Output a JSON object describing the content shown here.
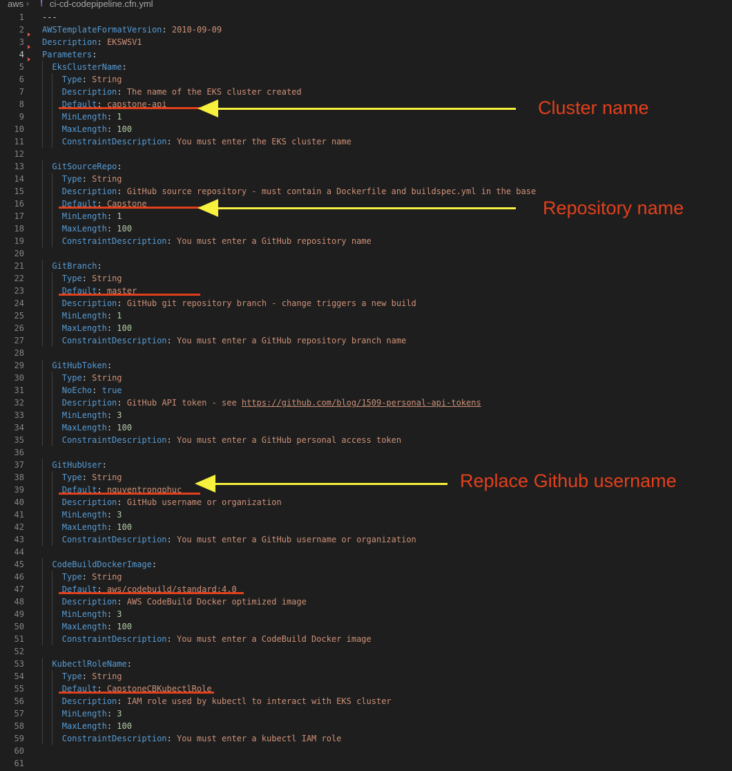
{
  "breadcrumb": {
    "folder": "aws",
    "separator": "›",
    "file_icon": "!",
    "file": "ci-cd-codepipeline.cfn.yml"
  },
  "annotations": {
    "cluster": "Cluster name",
    "repository": "Repository name",
    "github_user": "Replace Github username"
  },
  "colors": {
    "key": "#569cd6",
    "string": "#ce9178",
    "number": "#b5cea8",
    "underline": "#e2401c",
    "arrow": "#f7f03c",
    "annotation": "#e2401c"
  },
  "lines": [
    {
      "n": "1",
      "indent": 0,
      "raw": "---"
    },
    {
      "n": "2",
      "indent": 0,
      "key": "AWSTemplateFormatVersion",
      "val": "2010-09-09",
      "vt": "string"
    },
    {
      "n": "3",
      "indent": 0,
      "key": "Description",
      "val": "EKSWSV1",
      "vt": "string"
    },
    {
      "n": "4",
      "indent": 0,
      "key": "Parameters",
      "val": "",
      "vt": "none"
    },
    {
      "n": "5",
      "indent": 1,
      "key": "EksClusterName",
      "val": "",
      "vt": "none"
    },
    {
      "n": "6",
      "indent": 2,
      "key": "Type",
      "val": "String",
      "vt": "string"
    },
    {
      "n": "7",
      "indent": 2,
      "key": "Description",
      "val": "The name of the EKS cluster created",
      "vt": "string"
    },
    {
      "n": "8",
      "indent": 2,
      "key": "Default",
      "val": "capstone-api",
      "vt": "string"
    },
    {
      "n": "9",
      "indent": 2,
      "key": "MinLength",
      "val": "1",
      "vt": "number"
    },
    {
      "n": "10",
      "indent": 2,
      "key": "MaxLength",
      "val": "100",
      "vt": "number"
    },
    {
      "n": "11",
      "indent": 2,
      "key": "ConstraintDescription",
      "val": "You must enter the EKS cluster name",
      "vt": "string"
    },
    {
      "n": "12",
      "indent": 0,
      "blank": true
    },
    {
      "n": "13",
      "indent": 1,
      "key": "GitSourceRepo",
      "val": "",
      "vt": "none"
    },
    {
      "n": "14",
      "indent": 2,
      "key": "Type",
      "val": "String",
      "vt": "string"
    },
    {
      "n": "15",
      "indent": 2,
      "key": "Description",
      "val": "GitHub source repository - must contain a Dockerfile and buildspec.yml in the base",
      "vt": "string"
    },
    {
      "n": "16",
      "indent": 2,
      "key": "Default",
      "val": "Capstone",
      "vt": "string"
    },
    {
      "n": "17",
      "indent": 2,
      "key": "MinLength",
      "val": "1",
      "vt": "number"
    },
    {
      "n": "18",
      "indent": 2,
      "key": "MaxLength",
      "val": "100",
      "vt": "number"
    },
    {
      "n": "19",
      "indent": 2,
      "key": "ConstraintDescription",
      "val": "You must enter a GitHub repository name",
      "vt": "string"
    },
    {
      "n": "20",
      "indent": 0,
      "blank": true
    },
    {
      "n": "21",
      "indent": 1,
      "key": "GitBranch",
      "val": "",
      "vt": "none"
    },
    {
      "n": "22",
      "indent": 2,
      "key": "Type",
      "val": "String",
      "vt": "string"
    },
    {
      "n": "23",
      "indent": 2,
      "key": "Default",
      "val": "master",
      "vt": "string"
    },
    {
      "n": "24",
      "indent": 2,
      "key": "Description",
      "val": "GitHub git repository branch - change triggers a new build",
      "vt": "string"
    },
    {
      "n": "25",
      "indent": 2,
      "key": "MinLength",
      "val": "1",
      "vt": "number"
    },
    {
      "n": "26",
      "indent": 2,
      "key": "MaxLength",
      "val": "100",
      "vt": "number"
    },
    {
      "n": "27",
      "indent": 2,
      "key": "ConstraintDescription",
      "val": "You must enter a GitHub repository branch name",
      "vt": "string"
    },
    {
      "n": "28",
      "indent": 0,
      "blank": true
    },
    {
      "n": "29",
      "indent": 1,
      "key": "GitHubToken",
      "val": "",
      "vt": "none"
    },
    {
      "n": "30",
      "indent": 2,
      "key": "Type",
      "val": "String",
      "vt": "string"
    },
    {
      "n": "31",
      "indent": 2,
      "key": "NoEcho",
      "val": "true",
      "vt": "bool"
    },
    {
      "n": "32",
      "indent": 2,
      "key": "Description",
      "val": "GitHub API token - see ",
      "vt": "string",
      "url": "https://github.com/blog/1509-personal-api-tokens"
    },
    {
      "n": "33",
      "indent": 2,
      "key": "MinLength",
      "val": "3",
      "vt": "number"
    },
    {
      "n": "34",
      "indent": 2,
      "key": "MaxLength",
      "val": "100",
      "vt": "number"
    },
    {
      "n": "35",
      "indent": 2,
      "key": "ConstraintDescription",
      "val": "You must enter a GitHub personal access token",
      "vt": "string"
    },
    {
      "n": "36",
      "indent": 0,
      "blank": true
    },
    {
      "n": "37",
      "indent": 1,
      "key": "GitHubUser",
      "val": "",
      "vt": "none"
    },
    {
      "n": "38",
      "indent": 2,
      "key": "Type",
      "val": "String",
      "vt": "string"
    },
    {
      "n": "39",
      "indent": 2,
      "key": "Default",
      "val": "nguyentrongphuc",
      "vt": "string"
    },
    {
      "n": "40",
      "indent": 2,
      "key": "Description",
      "val": "GitHub username or organization",
      "vt": "string"
    },
    {
      "n": "41",
      "indent": 2,
      "key": "MinLength",
      "val": "3",
      "vt": "number"
    },
    {
      "n": "42",
      "indent": 2,
      "key": "MaxLength",
      "val": "100",
      "vt": "number"
    },
    {
      "n": "43",
      "indent": 2,
      "key": "ConstraintDescription",
      "val": "You must enter a GitHub username or organization",
      "vt": "string"
    },
    {
      "n": "44",
      "indent": 0,
      "blank": true
    },
    {
      "n": "45",
      "indent": 1,
      "key": "CodeBuildDockerImage",
      "val": "",
      "vt": "none"
    },
    {
      "n": "46",
      "indent": 2,
      "key": "Type",
      "val": "String",
      "vt": "string"
    },
    {
      "n": "47",
      "indent": 2,
      "key": "Default",
      "val": "aws/codebuild/standard:4.0",
      "vt": "string"
    },
    {
      "n": "48",
      "indent": 2,
      "key": "Description",
      "val": "AWS CodeBuild Docker optimized image",
      "vt": "string"
    },
    {
      "n": "49",
      "indent": 2,
      "key": "MinLength",
      "val": "3",
      "vt": "number"
    },
    {
      "n": "50",
      "indent": 2,
      "key": "MaxLength",
      "val": "100",
      "vt": "number"
    },
    {
      "n": "51",
      "indent": 2,
      "key": "ConstraintDescription",
      "val": "You must enter a CodeBuild Docker image",
      "vt": "string"
    },
    {
      "n": "52",
      "indent": 0,
      "blank": true
    },
    {
      "n": "53",
      "indent": 1,
      "key": "KubectlRoleName",
      "val": "",
      "vt": "none"
    },
    {
      "n": "54",
      "indent": 2,
      "key": "Type",
      "val": "String",
      "vt": "string"
    },
    {
      "n": "55",
      "indent": 2,
      "key": "Default",
      "val": "CapstoneCBKubectlRole",
      "vt": "string"
    },
    {
      "n": "56",
      "indent": 2,
      "key": "Description",
      "val": "IAM role used by kubectl to interact with EKS cluster",
      "vt": "string"
    },
    {
      "n": "57",
      "indent": 2,
      "key": "MinLength",
      "val": "3",
      "vt": "number"
    },
    {
      "n": "58",
      "indent": 2,
      "key": "MaxLength",
      "val": "100",
      "vt": "number"
    },
    {
      "n": "59",
      "indent": 2,
      "key": "ConstraintDescription",
      "val": "You must enter a kubectl IAM role",
      "vt": "string"
    },
    {
      "n": "60",
      "indent": 0,
      "blank": true
    },
    {
      "n": "61",
      "indent": 0,
      "blank": true
    }
  ]
}
